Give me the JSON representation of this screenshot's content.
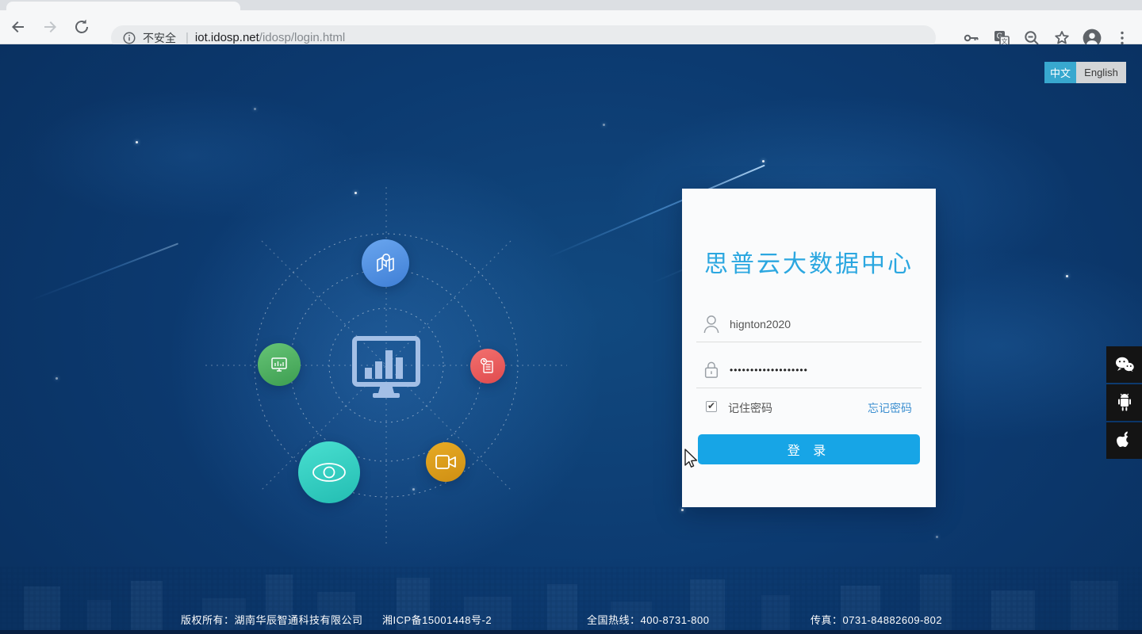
{
  "browser": {
    "security_label": "不安全",
    "url_host": "iot.idosp.net",
    "url_path": "/idosp/login.html"
  },
  "language_toggle": {
    "chinese_label": "中文",
    "english_label": "English",
    "active": "chinese"
  },
  "login": {
    "title": "思普云大数据中心",
    "username_value": "hignton2020",
    "password_value": "•••••••••••••••••••",
    "remember_label": "记住密码",
    "remember_checked": true,
    "forgot_password_label": "忘记密码",
    "login_button_label": "登 录"
  },
  "hub": {
    "center_icon": "dashboard-monitor-icon",
    "nodes": [
      {
        "icon": "map-location-icon",
        "color": "#4a8de2"
      },
      {
        "icon": "device-monitor-icon",
        "color": "#4cae5e"
      },
      {
        "icon": "report-document-icon",
        "color": "#ea5757"
      },
      {
        "icon": "eye-monitoring-icon",
        "color": "#35d0c1"
      },
      {
        "icon": "video-camera-icon",
        "color": "#daa01d"
      }
    ]
  },
  "social_rail": [
    {
      "icon": "wechat-icon"
    },
    {
      "icon": "android-icon"
    },
    {
      "icon": "apple-icon"
    }
  ],
  "footer": {
    "copyright": "版权所有：湖南华辰智通科技有限公司",
    "icp": "湘ICP备15001448号-2",
    "hotline": "全国热线：400-8731-800",
    "fax": "传真：0731-84882609-802"
  },
  "colors": {
    "accent_button_blue": "#17a5e6",
    "title_blue": "#2ba7e0",
    "link_blue": "#3c8fd0",
    "background_navy": "#0c3a70",
    "lang_active_teal": "#38a8cf"
  }
}
